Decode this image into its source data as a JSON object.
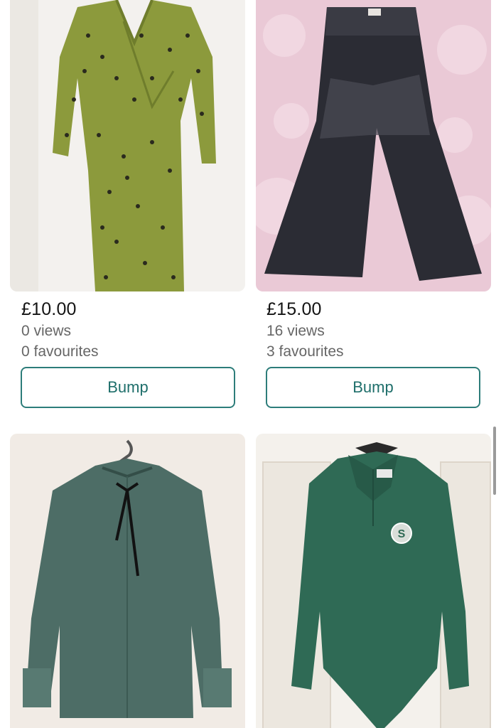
{
  "listings": [
    {
      "price": "£10.00",
      "views": "0 views",
      "favourites": "0 favourites",
      "action": "Bump",
      "photo": "green leopard print wrap dress on white wall"
    },
    {
      "price": "£15.00",
      "views": "16 views",
      "favourites": "3 favourites",
      "action": "Bump",
      "photo": "black wide-leg jeans on pink fluffy rug"
    },
    {
      "photo": "green satin blouse with black neck tie on hanger"
    },
    {
      "photo": "green long-sleeve collared bodysuit on hanger"
    }
  ],
  "colors": {
    "accent": "#2d7d7a",
    "price_text": "#141414",
    "meta_text": "#666666"
  }
}
